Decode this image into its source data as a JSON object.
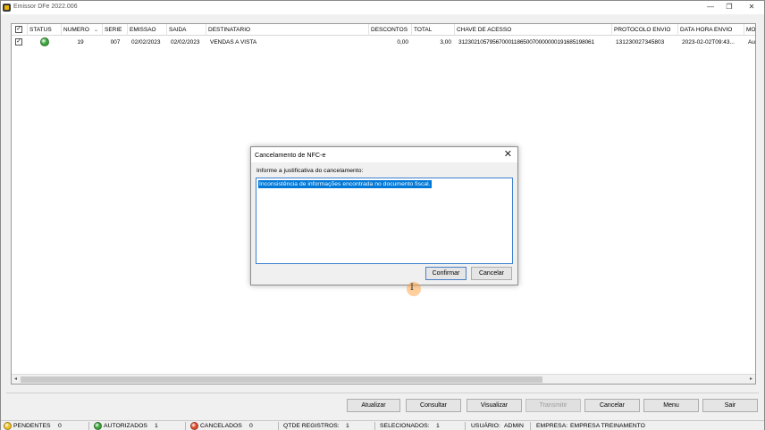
{
  "window": {
    "title": "Emissor DFe 2022.006",
    "min": "—",
    "max": "❐",
    "close": "✕"
  },
  "grid": {
    "headers": [
      "STATUS",
      "NUMERO",
      "SERIE",
      "EMISSAO",
      "SAIDA",
      "DESTINATARIO",
      "DESCONTOS",
      "TOTAL",
      "CHAVE DE ACESSO",
      "PROTOCOLO ENVIO",
      "DATA HORA ENVIO",
      "MOT"
    ],
    "sort_indicator": "⌄",
    "rows": [
      {
        "checked": "✓",
        "status_color": "#3aa63a",
        "numero": "19",
        "serie": "007",
        "emissao": "02/02/2023",
        "saida": "02/02/2023",
        "destinatario": "VENDAS A VISTA",
        "descontos": "0,00",
        "total": "3,00",
        "chave": "31230210579567000118650070000000191685198061",
        "protocolo": "131230027345803",
        "data_hora": "2023-02-02T09:43...",
        "mot": "Aut"
      }
    ],
    "header_check": "✓"
  },
  "dialog": {
    "title": "Cancelamento de NFC-e",
    "label": "Informe a justificativa do cancelamento:",
    "text": "Inconsistência de informações encontrada no documento fiscal.",
    "confirm": "Confirmar",
    "cancel": "Cancelar",
    "close": "✕",
    "cursor": "I"
  },
  "toolbar": [
    "Atualizar",
    "Consultar",
    "Visualizar",
    "Transmitir",
    "Cancelar",
    "Menu",
    "Sair"
  ],
  "statusbar": {
    "pendentes_label": "PENDENTES",
    "pendentes_value": "0",
    "pendentes_color": "#f0c020",
    "autorizados_label": "AUTORIZADOS",
    "autorizados_value": "1",
    "autorizados_color": "#3aa63a",
    "cancelados_label": "CANCELADOS",
    "cancelados_value": "0",
    "cancelados_color": "#e04a2a",
    "qtde_label": "QTDE REGISTROS:",
    "qtde_value": "1",
    "selecionados_label": "SELECIONADOS:",
    "selecionados_value": "1",
    "usuario_label": "USUÁRIO:",
    "usuario_value": "ADMIN",
    "empresa_label": "EMPRESA:",
    "empresa_value": "EMPRESA TREINAMENTO"
  },
  "scroll": {
    "left": "◂",
    "right": "▸"
  }
}
